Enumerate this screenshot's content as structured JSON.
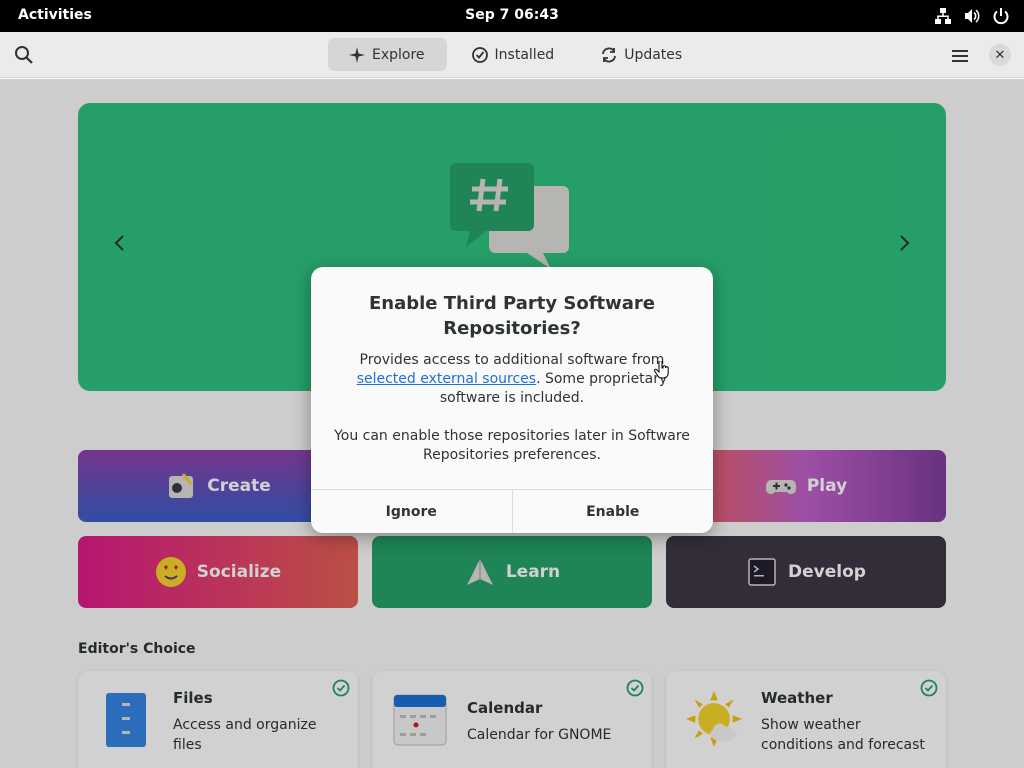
{
  "topbar": {
    "activities": "Activities",
    "clock": "Sep 7  06:43",
    "tray_icons": [
      "network-icon",
      "volume-icon",
      "power-icon"
    ]
  },
  "header": {
    "tabs": [
      {
        "label": "Explore",
        "icon": "sparkle-icon",
        "active": true
      },
      {
        "label": "Installed",
        "icon": "check-circle-icon",
        "active": false
      },
      {
        "label": "Updates",
        "icon": "refresh-icon",
        "active": false
      }
    ],
    "search_icon": "search-icon",
    "menu_icon": "hamburger-menu-icon",
    "close_label": "✕"
  },
  "banner": {
    "color": "#2ec27e",
    "icon": "chat-hash-icon"
  },
  "categories": [
    {
      "label": "Create",
      "icon": "create-icon"
    },
    {
      "label": "Play",
      "icon": "gamepad-icon"
    },
    {
      "label": "Socialize",
      "icon": "emoji-heart-eyes-icon"
    },
    {
      "label": "Learn",
      "icon": "paper-plane-icon"
    },
    {
      "label": "Develop",
      "icon": "terminal-icon"
    }
  ],
  "editors_choice": {
    "title": "Editor's Choice",
    "apps": [
      {
        "name": "Files",
        "description": "Access and organize files",
        "installed": true
      },
      {
        "name": "Calendar",
        "description": "Calendar for GNOME",
        "installed": true
      },
      {
        "name": "Weather",
        "description": "Show weather conditions and forecast",
        "installed": true
      }
    ]
  },
  "dialog": {
    "title": "Enable Third Party Software Repositories?",
    "body_prefix": "Provides access to additional software from ",
    "body_link": "selected external sources",
    "body_suffix": ". Some proprietary software is included.",
    "body2": "You can enable those repositories later in Software Repositories preferences.",
    "ignore_label": "Ignore",
    "enable_label": "Enable"
  },
  "colors": {
    "accent_link": "#1c71d8",
    "check_green": "#26a269"
  }
}
